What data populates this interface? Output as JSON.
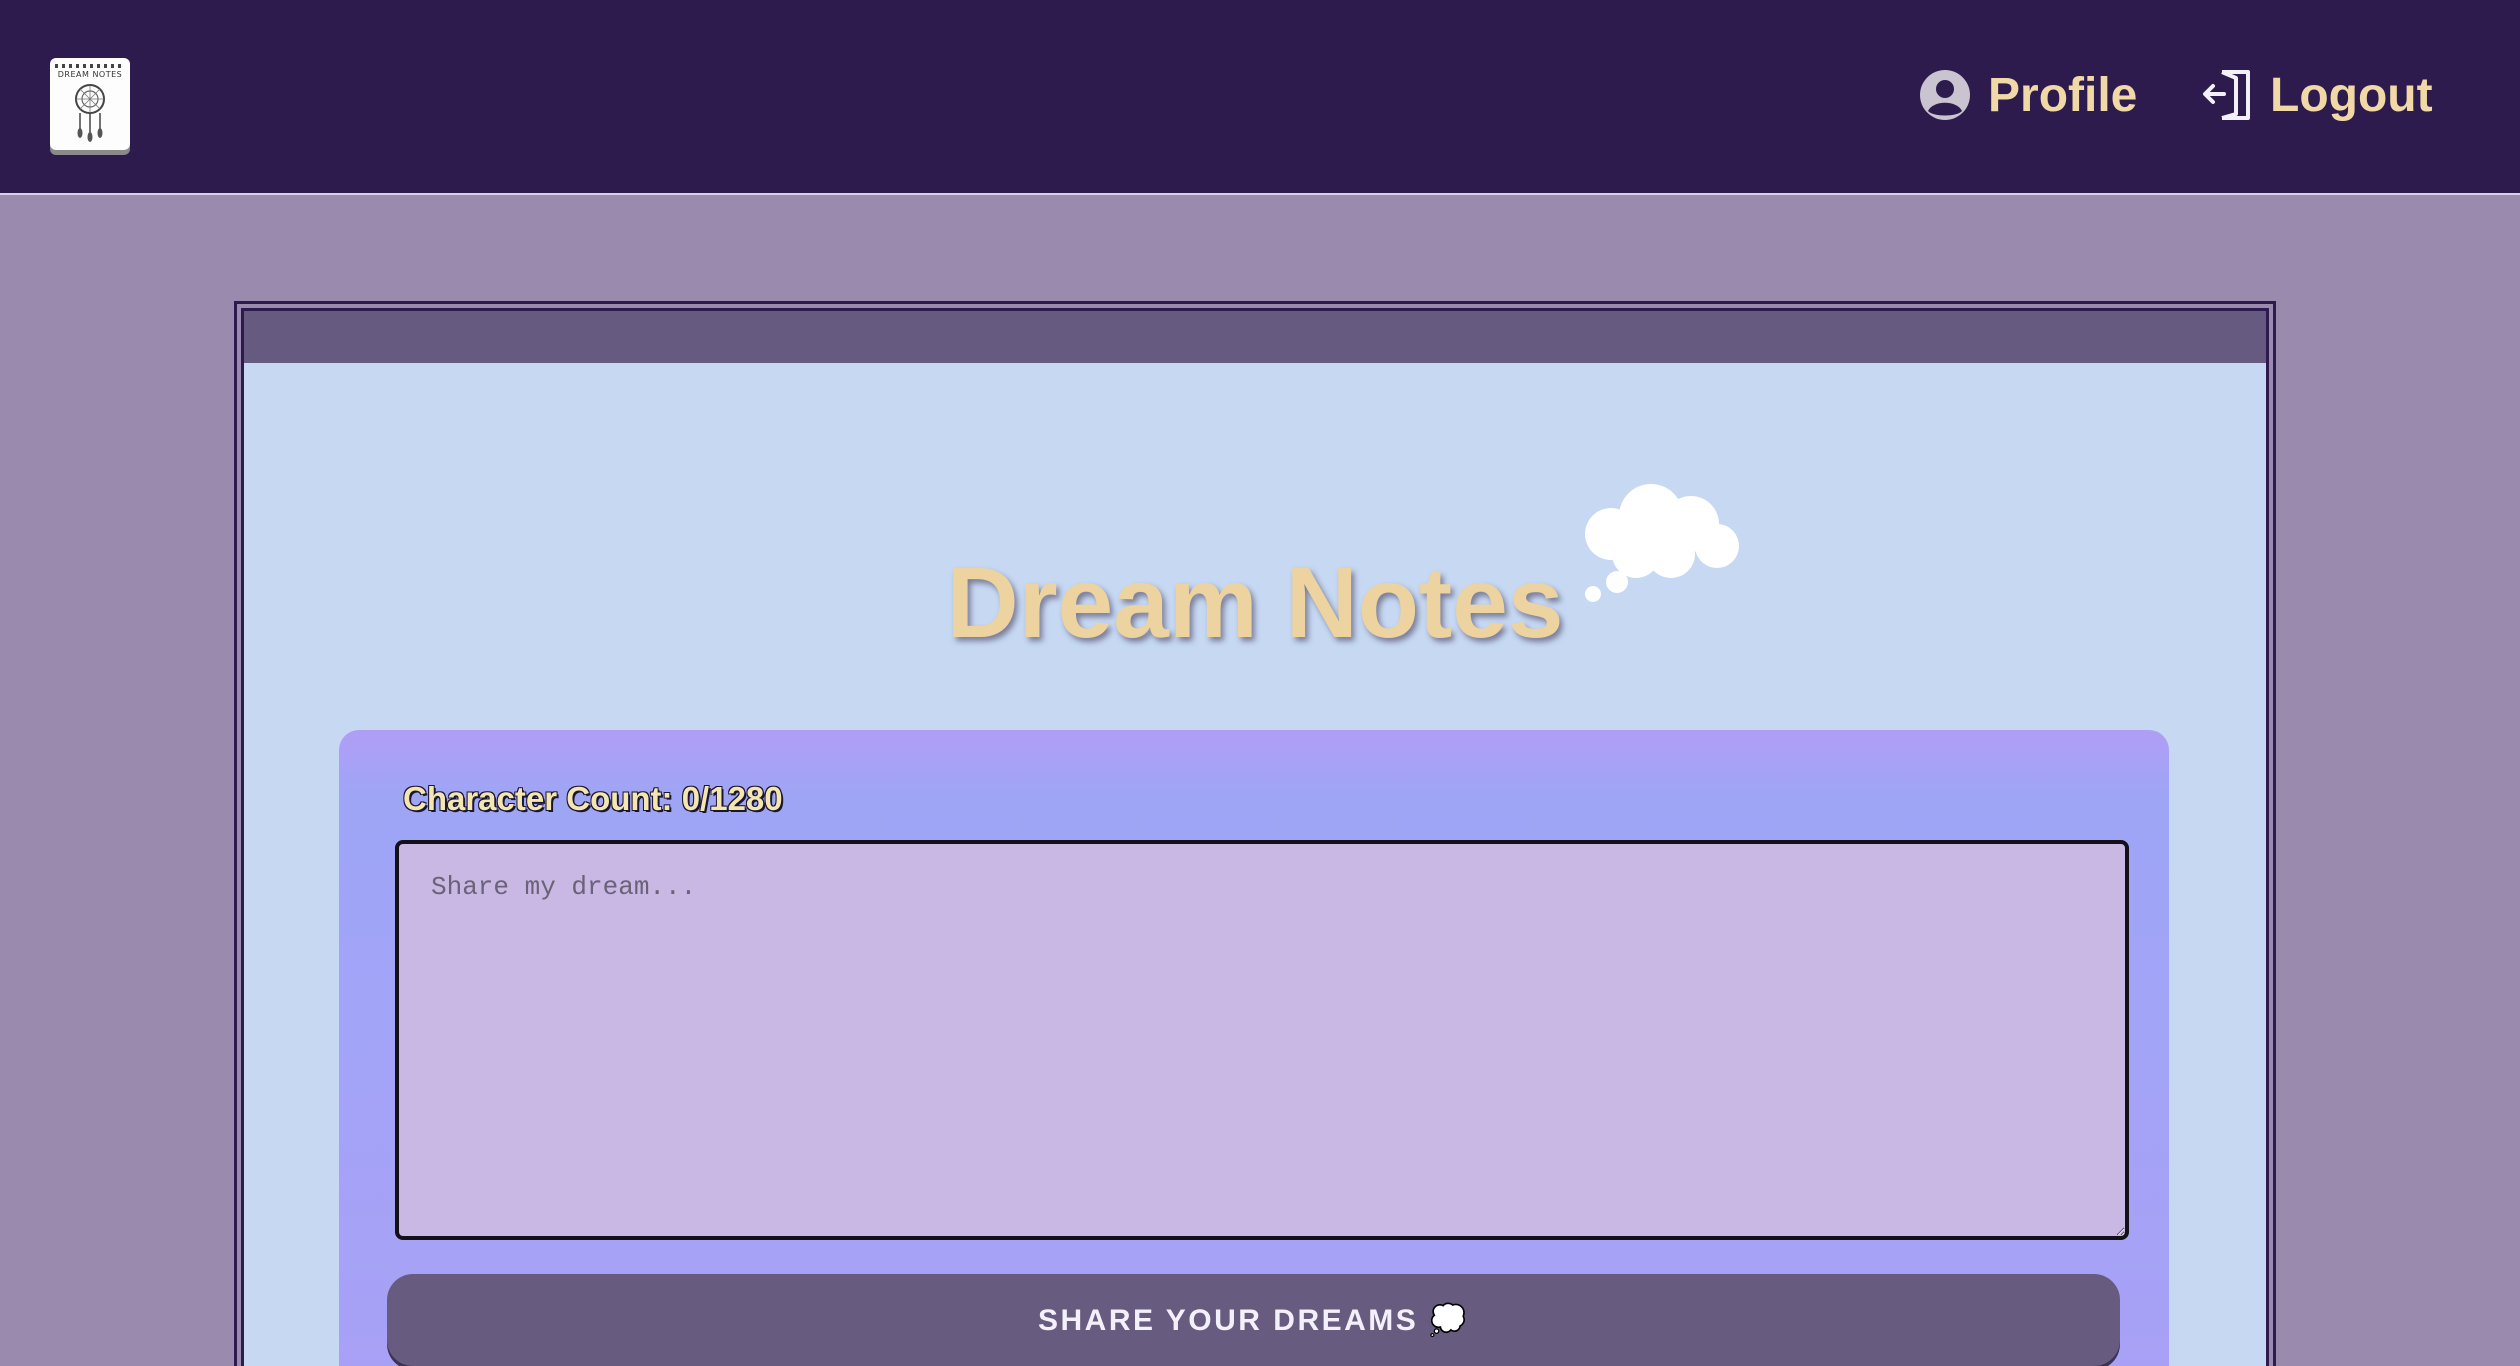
{
  "logo": {
    "text": "DREAM NOTES"
  },
  "nav": {
    "profile_label": "Profile",
    "logout_label": "Logout"
  },
  "main": {
    "title": "Dream Notes"
  },
  "form": {
    "char_count_label": "Character Count: 0/1280",
    "dream_placeholder": "Share my dream...",
    "dream_value": "",
    "submit_label": "SHARE YOUR DREAMS 💭"
  },
  "colors": {
    "header_bg": "#2d1b4e",
    "page_bg": "#9a8aae",
    "window_bg": "#c6d8f2",
    "accent_text": "#ecd39f",
    "button_bg": "#675b80"
  },
  "icons": {
    "logo": "dreamcatcher-notebook-logo",
    "profile": "user-circle-icon",
    "logout": "door-exit-icon",
    "title": "thought-cloud-icon"
  }
}
